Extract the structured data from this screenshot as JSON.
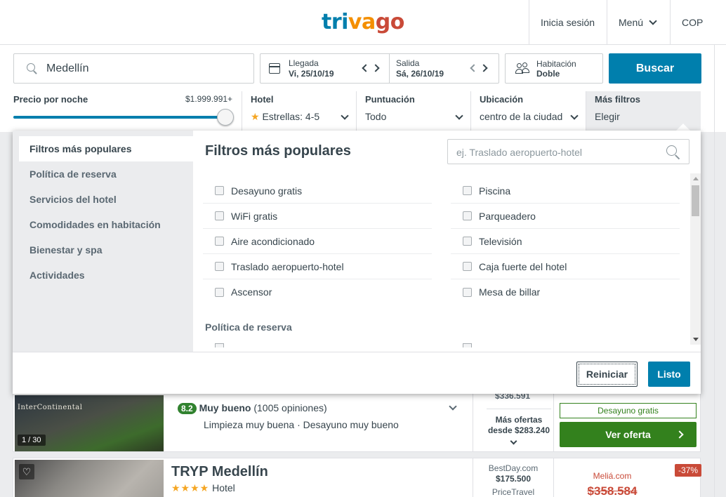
{
  "header": {
    "logo": {
      "part1": "tri",
      "part2": "va",
      "part3": "go"
    },
    "login": "Inicia sesión",
    "menu": "Menú",
    "currency": "COP"
  },
  "search": {
    "destination": "Medellín",
    "checkin_label": "Llegada",
    "checkin_value": "Vi, 25/10/19",
    "checkout_label": "Salida",
    "checkout_value": "Sá, 26/10/19",
    "room_label": "Habitación",
    "room_value": "Doble",
    "search_button": "Buscar"
  },
  "filters": {
    "price_label": "Precio por noche",
    "price_value": "$1.999.991+",
    "price_slider_fraction": 1.0,
    "hotel": {
      "title": "Hotel",
      "value": "Estrellas: 4-5"
    },
    "rating": {
      "title": "Puntuación",
      "value": "Todo"
    },
    "location": {
      "title": "Ubicación",
      "value": "centro de la ciudad"
    },
    "more": {
      "title": "Más filtros",
      "value": "Elegir"
    }
  },
  "modal": {
    "nav": [
      "Filtros más populares",
      "Política de reserva",
      "Servicios del hotel",
      "Comodidades en habitación",
      "Bienestar y spa",
      "Actividades"
    ],
    "title": "Filtros más populares",
    "search_placeholder": "ej. Traslado aeropuerto-hotel",
    "options_left": [
      "Desayuno gratis",
      "WiFi gratis",
      "Aire acondicionado",
      "Traslado aeropuerto-hotel",
      "Ascensor"
    ],
    "options_right": [
      "Piscina",
      "Parqueadero",
      "Televisión",
      "Caja fuerte del hotel",
      "Mesa de billar"
    ],
    "section2_title": "Política de reserva",
    "reset_button": "Reiniciar",
    "done_button": "Listo"
  },
  "hotels": [
    {
      "brand_text": "InterContinental",
      "photo_counter": "1 / 30",
      "score": "8.2",
      "score_text": "Muy bueno",
      "reviews": "(1005 opiniones)",
      "highlights": "Limpieza muy buena · Desayuno muy bueno",
      "price_partial": "$336.591",
      "more_offers_1": "Más ofertas",
      "more_offers_2": "desde $283.240",
      "breakfast_tag": "Desayuno gratis",
      "deal_button": "Ver oferta"
    },
    {
      "name": "TRYP Medellín",
      "stars": "★★★★",
      "type": "Hotel",
      "partner1": "BestDay.com",
      "partner1_price": "$175.500",
      "partner2": "PriceTravel",
      "main_partner": "Meliá.com",
      "old_price": "$358.584",
      "discount": "-37%"
    }
  ],
  "colors": {
    "brand_blue": "#007fad",
    "green": "#33811d",
    "score_green": "#31822f",
    "discount_red": "#c94a38"
  }
}
